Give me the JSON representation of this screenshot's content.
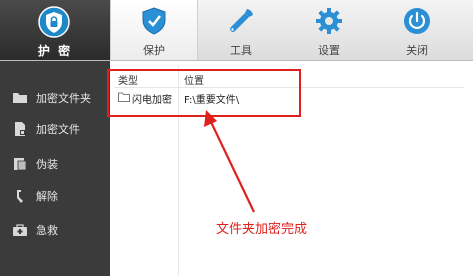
{
  "brand": {
    "title": "护 密",
    "icon": "shield-lock-icon"
  },
  "toolbar": [
    {
      "label": "保护",
      "icon": "shield-icon",
      "active": true
    },
    {
      "label": "工具",
      "icon": "wrench-icon",
      "active": false
    },
    {
      "label": "设置",
      "icon": "gear-icon",
      "active": false
    },
    {
      "label": "关闭",
      "icon": "power-icon",
      "active": false
    }
  ],
  "sidebar": {
    "items": [
      {
        "label": "加密文件夹",
        "icon": "folder-icon"
      },
      {
        "label": "加密文件",
        "icon": "file-icon"
      },
      {
        "label": "伪装",
        "icon": "disguise-icon"
      },
      {
        "label": "解除",
        "icon": "unlock-icon"
      },
      {
        "label": "急救",
        "icon": "first-aid-icon"
      }
    ]
  },
  "table": {
    "columns": [
      "类型",
      "位置"
    ],
    "rows": [
      {
        "type": "闪电加密",
        "location": "F:\\重要文件\\"
      }
    ]
  },
  "annotation": {
    "text": "文件夹加密完成",
    "color": "#e0201c"
  }
}
